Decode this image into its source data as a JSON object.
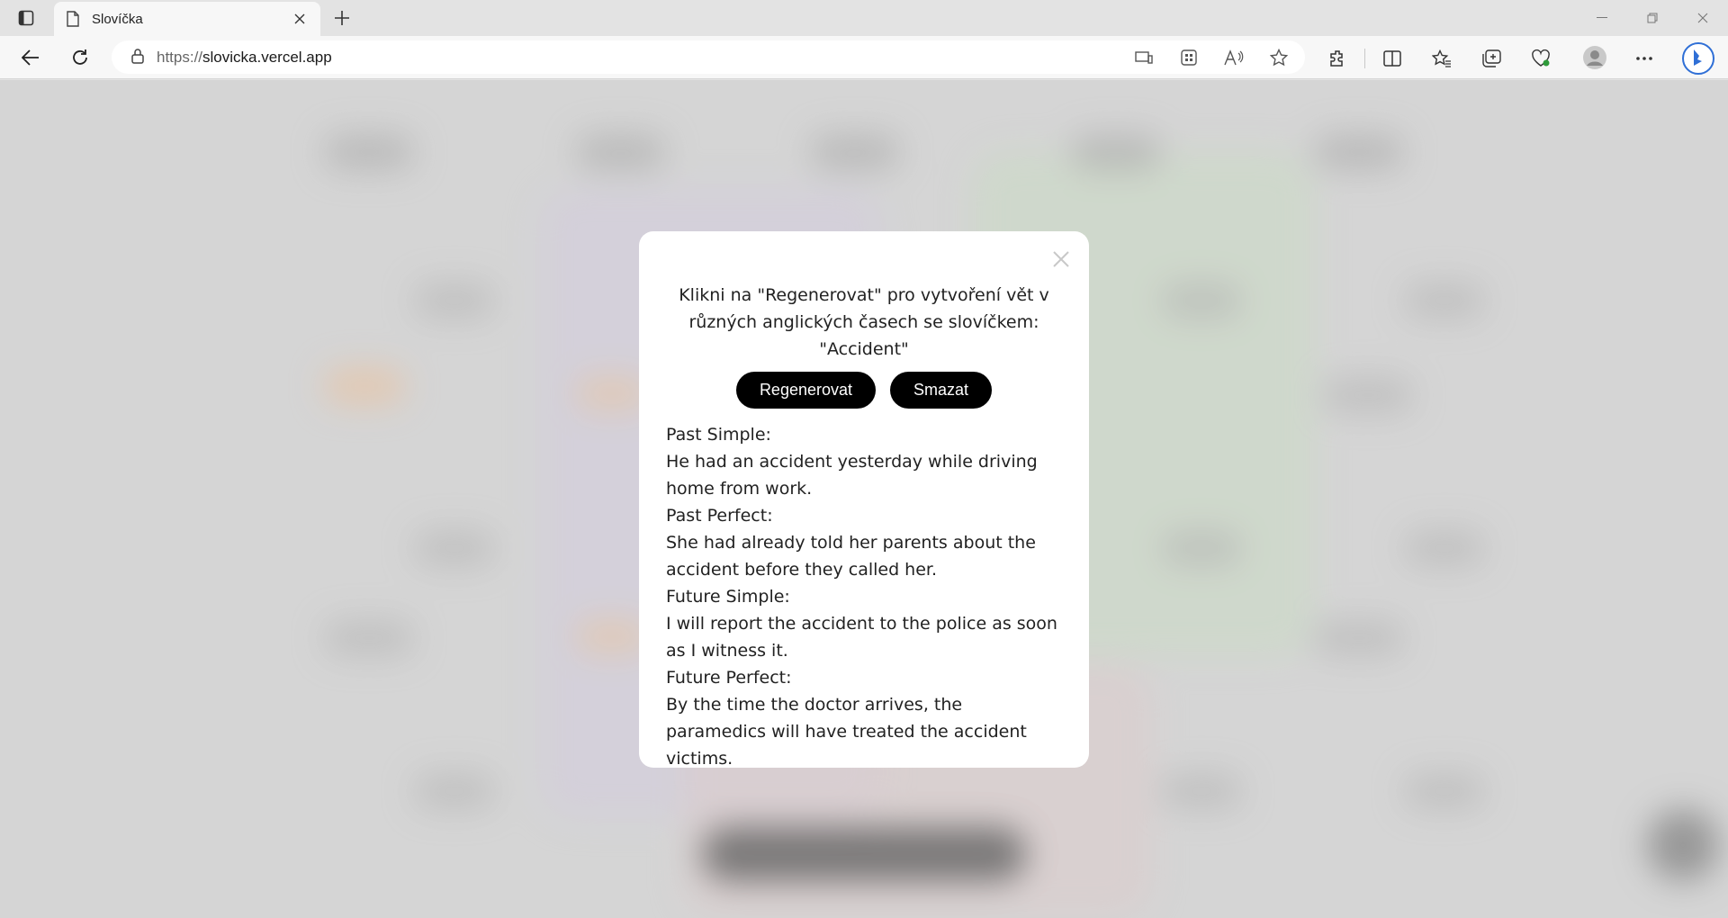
{
  "browser": {
    "tab": {
      "title": "Slovíčka"
    },
    "url": {
      "scheme": "https://",
      "host": "slovicka.vercel.app"
    }
  },
  "modal": {
    "prompt_line1": "Klikni na \"Regenerovat\" pro vytvoření vět v",
    "prompt_line2": "různých anglických časech se slovíčkem:",
    "prompt_line3": "\"Accident\"",
    "regenerate_label": "Regenerovat",
    "delete_label": "Smazat",
    "results": [
      {
        "tense": "Past Simple:",
        "sentence": "He had an accident yesterday while driving home from work."
      },
      {
        "tense": "Past Perfect:",
        "sentence": "She had already told her parents about the accident before they called her."
      },
      {
        "tense": "Future Simple:",
        "sentence": "I will report the accident to the police as soon as I witness it."
      },
      {
        "tense": "Future Perfect:",
        "sentence": "By the time the doctor arrives, the paramedics will have treated the accident victims."
      }
    ]
  },
  "colors": {
    "button_bg": "#000000",
    "button_text": "#ffffff",
    "modal_bg": "#ffffff",
    "accent_orange": "#f3c7a0",
    "accent_green": "#cfe3c8",
    "accent_purple": "#d8d2e6"
  }
}
